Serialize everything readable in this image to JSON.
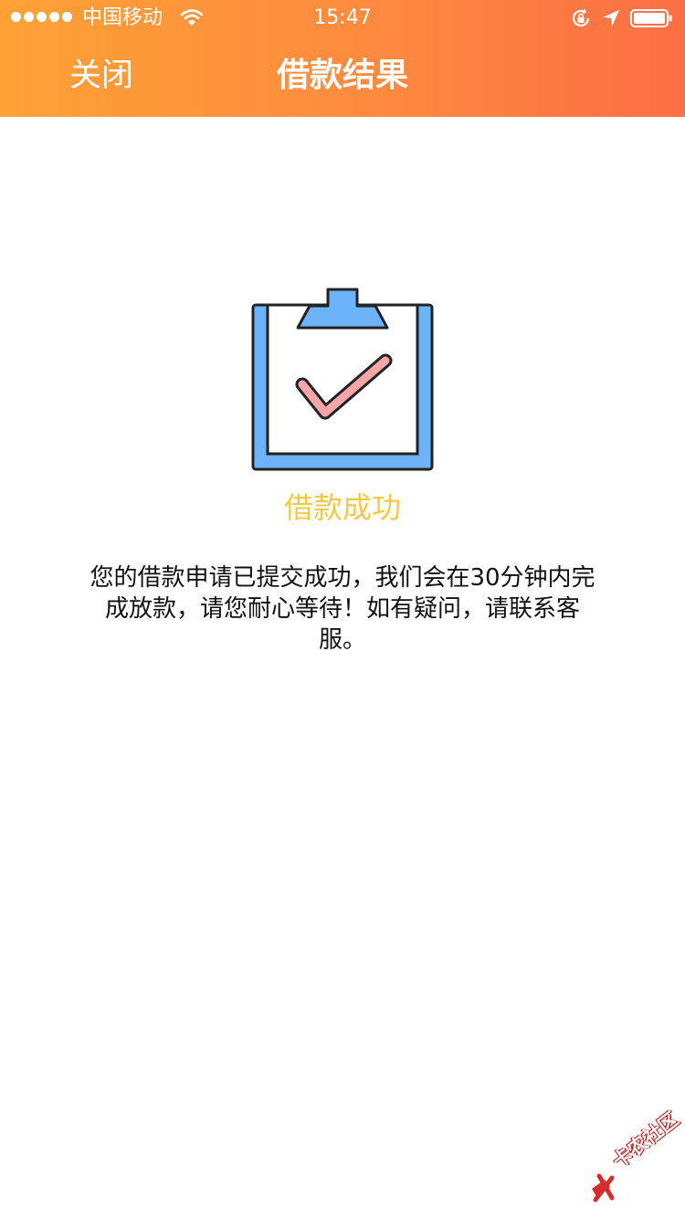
{
  "status_bar": {
    "carrier": "中国移动",
    "time": "15:47"
  },
  "nav": {
    "close_label": "关闭",
    "title": "借款结果"
  },
  "result": {
    "title": "借款成功",
    "message": "您的借款申请已提交成功，我们会在30分钟内完成放款，请您耐心等待！如有疑问，请联系客服。"
  },
  "watermark": {
    "text": "卡农社区"
  },
  "colors": {
    "nav_gradient_start": "#fda135",
    "nav_gradient_end": "#fc6e45",
    "success_title": "#f5c842",
    "clipboard_blue": "#6db3f9",
    "check_pink": "#f6a6a6"
  }
}
